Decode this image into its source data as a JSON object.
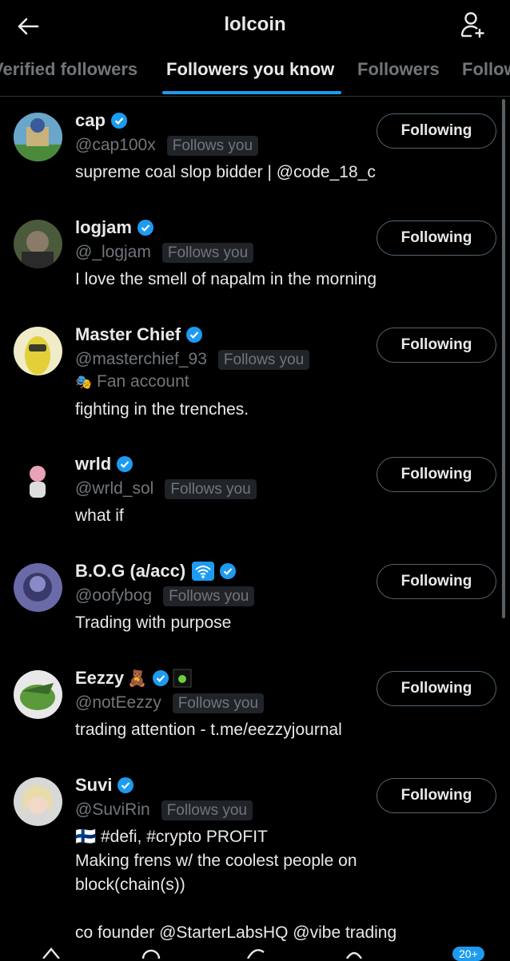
{
  "header": {
    "title": "lolcoin"
  },
  "tabs": [
    {
      "label": "Verified followers",
      "active": false
    },
    {
      "label": "Followers you know",
      "active": true
    },
    {
      "label": "Followers",
      "active": false
    },
    {
      "label": "Following",
      "active": false
    }
  ],
  "users": [
    {
      "name": "cap",
      "handle": "@cap100x",
      "badge": "Follows you",
      "bio": [
        "supreme coal slop bidder | @code_18_c"
      ],
      "button": "Following"
    },
    {
      "name": "logjam",
      "handle": "@_logjam",
      "badge": "Follows you",
      "bio": [
        "I love the smell of napalm in the morning"
      ],
      "button": "Following"
    },
    {
      "name": "Master Chief",
      "handle": "@masterchief_93",
      "badge": "Follows you",
      "sub": "Fan account",
      "bio": [
        "fighting in the trenches."
      ],
      "button": "Following"
    },
    {
      "name": "wrld",
      "handle": "@wrld_sol",
      "badge": "Follows you",
      "bio": [
        "what if"
      ],
      "button": "Following"
    },
    {
      "name": "B.O.G (a/acc)",
      "handle": "@oofybog",
      "badge": "Follows you",
      "bio": [
        "Trading with purpose"
      ],
      "button": "Following"
    },
    {
      "name": "Eezzy",
      "name_emoji": "🧸",
      "handle": "@notEezzy",
      "badge": "Follows you",
      "bio": [
        "trading attention - t.me/eezzyjournal"
      ],
      "button": "Following"
    },
    {
      "name": "Suvi",
      "handle": "@SuviRin",
      "badge": "Follows you",
      "bio": [
        "🇫🇮 #defi, #crypto PROFIT",
        "Making frens w/ the coolest people on",
        "block(chain(s))",
        "",
        "co founder @StarterLabsHQ @vibe trading"
      ],
      "button": "Following"
    }
  ],
  "bottom_badge": "20+",
  "colors": {
    "accent": "#1d9bf0",
    "background": "#000000",
    "muted": "#71767b"
  }
}
